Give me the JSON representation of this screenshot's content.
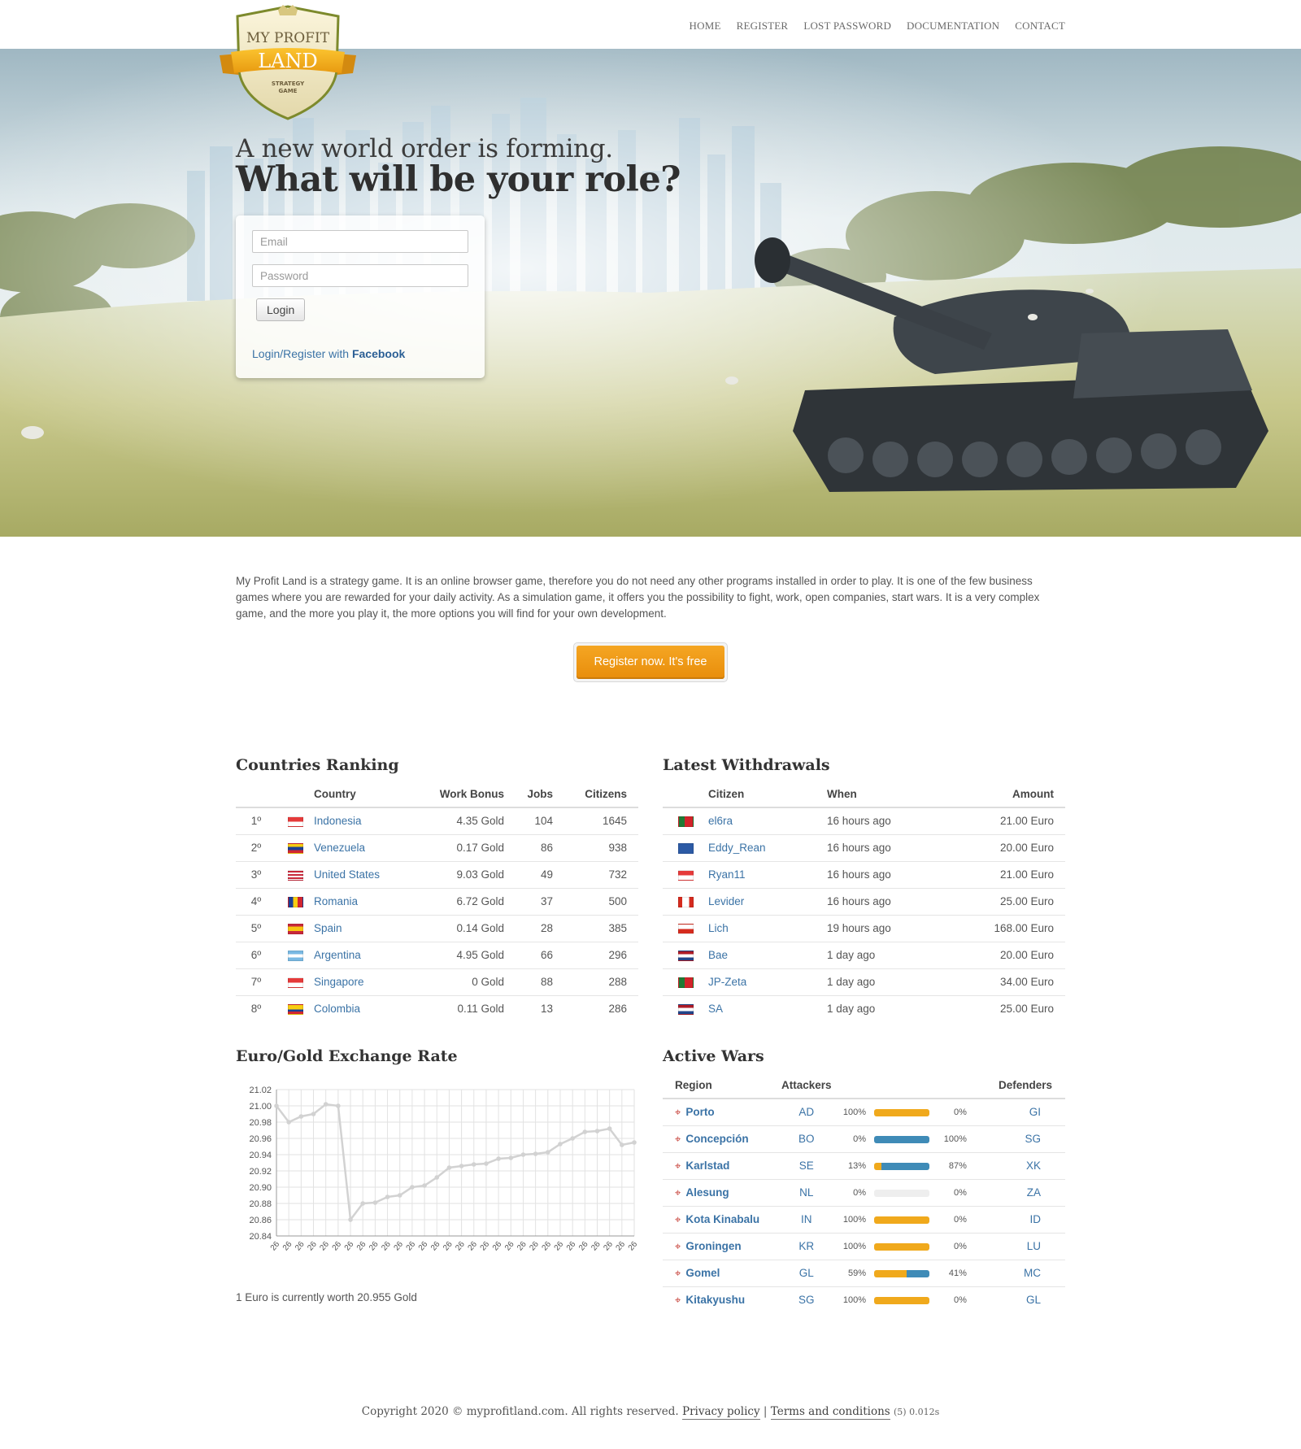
{
  "nav": [
    "HOME",
    "REGISTER",
    "LOST PASSWORD",
    "DOCUMENTATION",
    "CONTACT"
  ],
  "logo": {
    "line1": "MY PROFIT",
    "line2": "LAND",
    "line3": "STRATEGY",
    "line4": "GAME"
  },
  "hero": {
    "tagline": "A new world order is forming.",
    "title": "What will be your role?",
    "email_placeholder": "Email",
    "password_placeholder": "Password",
    "login_label": "Login",
    "fb_prefix": "Login/Register with ",
    "fb_brand": "Facebook"
  },
  "intro": "My Profit Land is a strategy game. It is an online browser game, therefore you do not need any other programs installed in order to play. It is one of the few business games where you are rewarded for your daily activity. As a simulation game, it offers you the possibility to fight, work, open companies, start wars. It is a very complex game, and the more you play it, the more options you will find for your own development.",
  "cta_label": "Register now. It's free",
  "ranking": {
    "title": "Countries Ranking",
    "headers": [
      "Country",
      "Work Bonus",
      "Jobs",
      "Citizens"
    ],
    "rows": [
      {
        "rank": "1º",
        "flag": "Indonesia",
        "country": "Indonesia",
        "bonus": "4.35 Gold",
        "jobs": "104",
        "citizens": "1645"
      },
      {
        "rank": "2º",
        "flag": "Venezuela",
        "country": "Venezuela",
        "bonus": "0.17 Gold",
        "jobs": "86",
        "citizens": "938"
      },
      {
        "rank": "3º",
        "flag": "United States",
        "country": "United States",
        "bonus": "9.03 Gold",
        "jobs": "49",
        "citizens": "732"
      },
      {
        "rank": "4º",
        "flag": "Romania",
        "country": "Romania",
        "bonus": "6.72 Gold",
        "jobs": "37",
        "citizens": "500"
      },
      {
        "rank": "5º",
        "flag": "Spain",
        "country": "Spain",
        "bonus": "0.14 Gold",
        "jobs": "28",
        "citizens": "385"
      },
      {
        "rank": "6º",
        "flag": "Argentina",
        "country": "Argentina",
        "bonus": "4.95 Gold",
        "jobs": "66",
        "citizens": "296"
      },
      {
        "rank": "7º",
        "flag": "Singapore",
        "country": "Singapore",
        "bonus": "0 Gold",
        "jobs": "88",
        "citizens": "288"
      },
      {
        "rank": "8º",
        "flag": "Colombia",
        "country": "Colombia",
        "bonus": "0.11 Gold",
        "jobs": "13",
        "citizens": "286"
      }
    ]
  },
  "withdrawals": {
    "title": "Latest Withdrawals",
    "headers": [
      "Citizen",
      "When",
      "Amount"
    ],
    "rows": [
      {
        "flag": "Portugal",
        "citizen": "el6ra",
        "when": "16 hours ago",
        "amount": "21.00 Euro"
      },
      {
        "flag": "Kosovo",
        "citizen": "Eddy_Rean",
        "when": "16 hours ago",
        "amount": "20.00 Euro"
      },
      {
        "flag": "Indonesia",
        "citizen": "Ryan11",
        "when": "16 hours ago",
        "amount": "21.00 Euro"
      },
      {
        "flag": "Canada",
        "citizen": "Levider",
        "when": "16 hours ago",
        "amount": "25.00 Euro"
      },
      {
        "flag": "Chile",
        "citizen": "Lich",
        "when": "19 hours ago",
        "amount": "168.00 Euro"
      },
      {
        "flag": "Netherlands",
        "citizen": "Bae",
        "when": "1 day ago",
        "amount": "20.00 Euro"
      },
      {
        "flag": "Portugal",
        "citizen": "JP-Zeta",
        "when": "1 day ago",
        "amount": "34.00 Euro"
      },
      {
        "flag": "Netherlands",
        "citizen": "SA",
        "when": "1 day ago",
        "amount": "25.00 Euro"
      }
    ]
  },
  "exchange": {
    "title": "Euro/Gold Exchange Rate",
    "note": "1 Euro is currently worth 20.955 Gold"
  },
  "chart_data": {
    "type": "line",
    "title": "",
    "xlabel": "",
    "ylabel": "",
    "ylim": [
      20.84,
      21.02
    ],
    "yticks": [
      "21.02",
      "21.00",
      "20.98",
      "20.96",
      "20.94",
      "20.92",
      "20.90",
      "20.88",
      "20.86",
      "20.84"
    ],
    "grid": true,
    "categories": [
      "26",
      "26",
      "26",
      "26",
      "26",
      "26",
      "26",
      "26",
      "26",
      "26",
      "26",
      "26",
      "26",
      "26",
      "26",
      "26",
      "26",
      "26",
      "26",
      "26",
      "26",
      "26",
      "26",
      "26",
      "26",
      "26",
      "26",
      "26",
      "26",
      "26"
    ],
    "values": [
      21.0,
      20.98,
      20.987,
      20.99,
      21.002,
      21.0,
      20.86,
      20.88,
      20.881,
      20.888,
      20.89,
      20.9,
      20.902,
      20.912,
      20.924,
      20.926,
      20.928,
      20.929,
      20.935,
      20.936,
      20.94,
      20.941,
      20.943,
      20.953,
      20.96,
      20.968,
      20.969,
      20.972,
      20.952,
      20.955
    ],
    "color": "#d2d2d2"
  },
  "wars": {
    "title": "Active Wars",
    "headers": [
      "Region",
      "Attackers",
      "Defenders"
    ],
    "rows": [
      {
        "region": "Porto",
        "att": "AD",
        "att_pct": "100%",
        "def_pct": "0%",
        "def": "GI",
        "a": 100,
        "d": 0
      },
      {
        "region": "Concepción",
        "att": "BO",
        "att_pct": "0%",
        "def_pct": "100%",
        "def": "SG",
        "a": 0,
        "d": 100
      },
      {
        "region": "Karlstad",
        "att": "SE",
        "att_pct": "13%",
        "def_pct": "87%",
        "def": "XK",
        "a": 13,
        "d": 87
      },
      {
        "region": "Alesung",
        "att": "NL",
        "att_pct": "0%",
        "def_pct": "0%",
        "def": "ZA",
        "a": 0,
        "d": 0
      },
      {
        "region": "Kota Kinabalu",
        "att": "IN",
        "att_pct": "100%",
        "def_pct": "0%",
        "def": "ID",
        "a": 100,
        "d": 0
      },
      {
        "region": "Groningen",
        "att": "KR",
        "att_pct": "100%",
        "def_pct": "0%",
        "def": "LU",
        "a": 100,
        "d": 0
      },
      {
        "region": "Gomel",
        "att": "GL",
        "att_pct": "59%",
        "def_pct": "41%",
        "def": "MC",
        "a": 59,
        "d": 41
      },
      {
        "region": "Kitakyushu",
        "att": "SG",
        "att_pct": "100%",
        "def_pct": "0%",
        "def": "GL",
        "a": 100,
        "d": 0
      }
    ]
  },
  "footer": {
    "copyright": "Copyright 2020 © myprofitland.com. All rights reserved.",
    "privacy": "Privacy policy",
    "sep": "|",
    "terms": "Terms and conditions",
    "stats": "(5) 0.012s"
  },
  "colors": {
    "accent": "#f0a91c",
    "defender": "#3f8bb7",
    "link": "#3b73a6",
    "target": "#c53b33"
  }
}
